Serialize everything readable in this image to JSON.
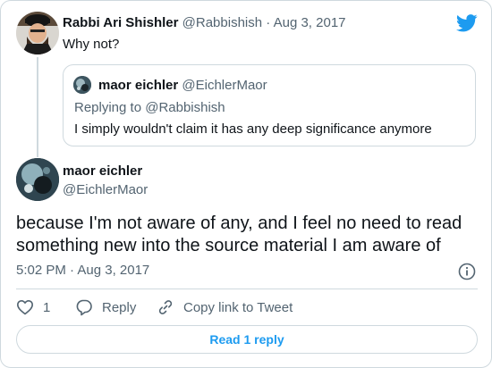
{
  "parent_tweet": {
    "author_name": "Rabbi Ari Shishler",
    "handle": "@Rabbishish",
    "separator": "·",
    "date": "Aug 3, 2017",
    "text": "Why not?",
    "avatar_icon": "avatar-photo"
  },
  "quoted_tweet": {
    "author_name": "maor eichler",
    "handle": "@EichlerMaor",
    "replying_to": "Replying to @Rabbishish",
    "text": "I simply wouldn't claim it has any deep significance anymore"
  },
  "main_tweet": {
    "author_name": "maor eichler",
    "handle": "@EichlerMaor",
    "text": "because I'm not aware of any, and I feel no need to read something new into the source material I am aware of",
    "timestamp": "5:02 PM · Aug 3, 2017"
  },
  "actions": {
    "like_count": "1",
    "reply_label": "Reply",
    "copy_link_label": "Copy link to Tweet"
  },
  "read_reply_label": "Read 1 reply",
  "colors": {
    "twitter_blue": "#1d9bf0",
    "muted_text": "#536471",
    "border": "#cfd9de",
    "text": "#0f1419"
  }
}
